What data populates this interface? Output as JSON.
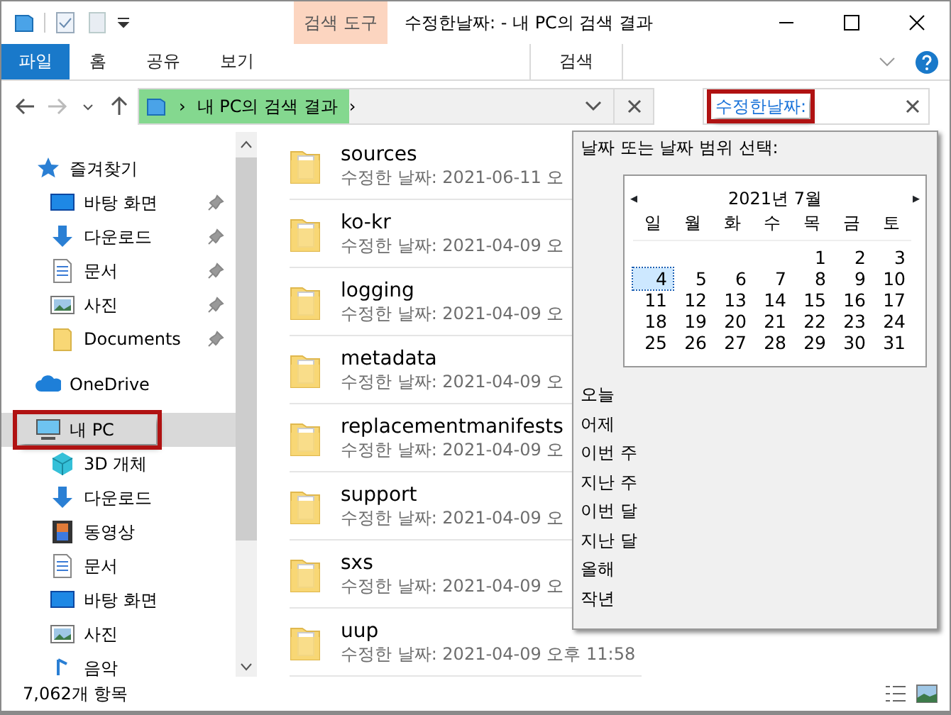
{
  "window": {
    "title": "수정한날짜: - 내 PC의 검색 결과"
  },
  "ribbon": {
    "context_group": "검색 도구",
    "tabs": [
      {
        "label": "파일",
        "kind": "file",
        "selected": false
      },
      {
        "label": "홈",
        "kind": "tab",
        "selected": false
      },
      {
        "label": "공유",
        "kind": "tab",
        "selected": false
      },
      {
        "label": "보기",
        "kind": "tab",
        "selected": false
      },
      {
        "label": "검색",
        "kind": "context",
        "selected": true
      }
    ]
  },
  "address": {
    "crumb": "내 PC의 검색 결과",
    "separator_1": "›",
    "separator_2": "›",
    "level": 0.41
  },
  "search": {
    "value": "수정한날짜:",
    "highlighted": true
  },
  "sidebar": {
    "items": [
      {
        "label": "즐겨찾기",
        "kind": "star",
        "selected": false,
        "highlighted": false,
        "children": [
          {
            "label": "바탕 화면",
            "kind": "desktop",
            "pinned": true
          },
          {
            "label": "다운로드",
            "kind": "download",
            "pinned": true
          },
          {
            "label": "문서",
            "kind": "document",
            "pinned": true
          },
          {
            "label": "사진",
            "kind": "photo",
            "pinned": true
          },
          {
            "label": "Documents",
            "kind": "folder",
            "pinned": true
          }
        ]
      },
      {
        "label": "OneDrive",
        "kind": "cloud",
        "selected": false,
        "highlighted": false
      },
      {
        "label": "내 PC",
        "kind": "pc",
        "selected": true,
        "highlighted": true,
        "children": [
          {
            "label": "3D 개체",
            "kind": "cube",
            "pinned": false
          },
          {
            "label": "다운로드",
            "kind": "download",
            "pinned": false
          },
          {
            "label": "동영상",
            "kind": "video",
            "pinned": false
          },
          {
            "label": "문서",
            "kind": "document",
            "pinned": false
          },
          {
            "label": "바탕 화면",
            "kind": "desktop",
            "pinned": false
          },
          {
            "label": "사진",
            "kind": "photo",
            "pinned": false
          },
          {
            "label": "음악",
            "kind": "music",
            "pinned": false
          }
        ]
      }
    ]
  },
  "files": [
    {
      "name": "sources",
      "date": "수정한 날짜: 2021-06-11 오"
    },
    {
      "name": "ko-kr",
      "date": "수정한 날짜: 2021-04-09 오"
    },
    {
      "name": "logging",
      "date": "수정한 날짜: 2021-04-09 오"
    },
    {
      "name": "metadata",
      "date": "수정한 날짜: 2021-04-09 오"
    },
    {
      "name": "replacementmanifests",
      "date": "수정한 날짜: 2021-04-09 오"
    },
    {
      "name": "support",
      "date": "수정한 날짜: 2021-04-09 오"
    },
    {
      "name": "sxs",
      "date": "수정한 날짜: 2021-04-09 오"
    },
    {
      "name": "uup",
      "date": "수정한 날짜: 2021-04-09 오후 11:58"
    }
  ],
  "date_popup": {
    "title": "날짜 또는 날짜 범위 선택:",
    "calendar": {
      "prev": "◂",
      "month": "2021년 7월",
      "next": "▸",
      "weekdays": [
        "일",
        "월",
        "화",
        "수",
        "목",
        "금",
        "토"
      ],
      "weeks": [
        [
          {
            "day": "1",
            "selected": false
          },
          {
            "day": "2",
            "selected": false
          },
          {
            "day": "3",
            "selected": false
          }
        ],
        [
          {
            "day": "4",
            "selected": true
          },
          {
            "day": "5",
            "selected": false
          },
          {
            "day": "6",
            "selected": false
          },
          {
            "day": "7",
            "selected": false
          },
          {
            "day": "8",
            "selected": false
          },
          {
            "day": "9",
            "selected": false
          },
          {
            "day": "10",
            "selected": false
          }
        ],
        [
          {
            "day": "11",
            "selected": false
          },
          {
            "day": "12",
            "selected": false
          },
          {
            "day": "13",
            "selected": false
          },
          {
            "day": "14",
            "selected": false
          },
          {
            "day": "15",
            "selected": false
          },
          {
            "day": "16",
            "selected": false
          },
          {
            "day": "17",
            "selected": false
          }
        ],
        [
          {
            "day": "18",
            "selected": false
          },
          {
            "day": "19",
            "selected": false
          },
          {
            "day": "20",
            "selected": false
          },
          {
            "day": "21",
            "selected": false
          },
          {
            "day": "22",
            "selected": false
          },
          {
            "day": "23",
            "selected": false
          },
          {
            "day": "24",
            "selected": false
          }
        ],
        [
          {
            "day": "25",
            "selected": false
          },
          {
            "day": "26",
            "selected": false
          },
          {
            "day": "27",
            "selected": false
          },
          {
            "day": "28",
            "selected": false
          },
          {
            "day": "29",
            "selected": false
          },
          {
            "day": "30",
            "selected": false
          },
          {
            "day": "31",
            "selected": false
          }
        ]
      ]
    },
    "ranges": [
      "오늘",
      "어제",
      "이번 주",
      "지난 주",
      "이번 달",
      "지난 달",
      "올해",
      "작년"
    ]
  },
  "status_bar": {
    "count": "7,062개 항목"
  }
}
